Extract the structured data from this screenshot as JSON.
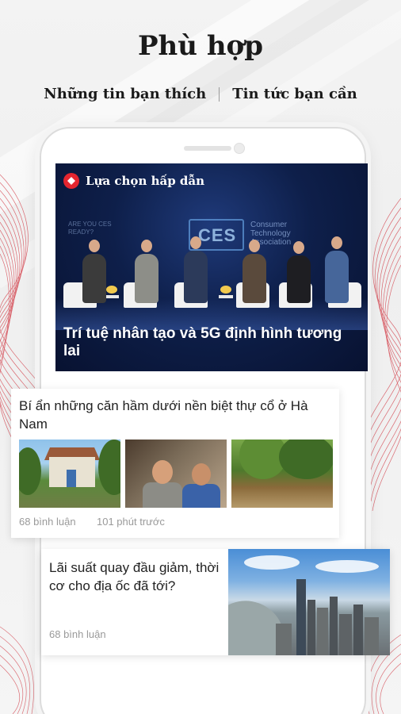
{
  "header": {
    "title": "Phù hợp",
    "tab_left": "Những tin bạn thích",
    "tab_right": "Tin tức bạn cần"
  },
  "featured": {
    "badge": "Lựa chọn hấp dẫn",
    "title": "Trí tuệ nhân tạo và 5G định hình tương lai",
    "screen_logo": "CES",
    "screen_assoc": "Consumer Technology Association",
    "screen_ready": "ARE YOU CES READY?"
  },
  "articles": [
    {
      "title": "Bí ẩn những căn hầm dưới nền biệt thự cổ ở Hà Nam",
      "comments": "68 bình luận",
      "time": "101 phút trước"
    },
    {
      "title": "Lãi suất quay đầu giảm, thời cơ cho địa ốc đã tới?",
      "comments": "68 bình luận"
    }
  ],
  "colors": {
    "accent": "#e4252f",
    "featured_bg": "#0d1a3a"
  }
}
